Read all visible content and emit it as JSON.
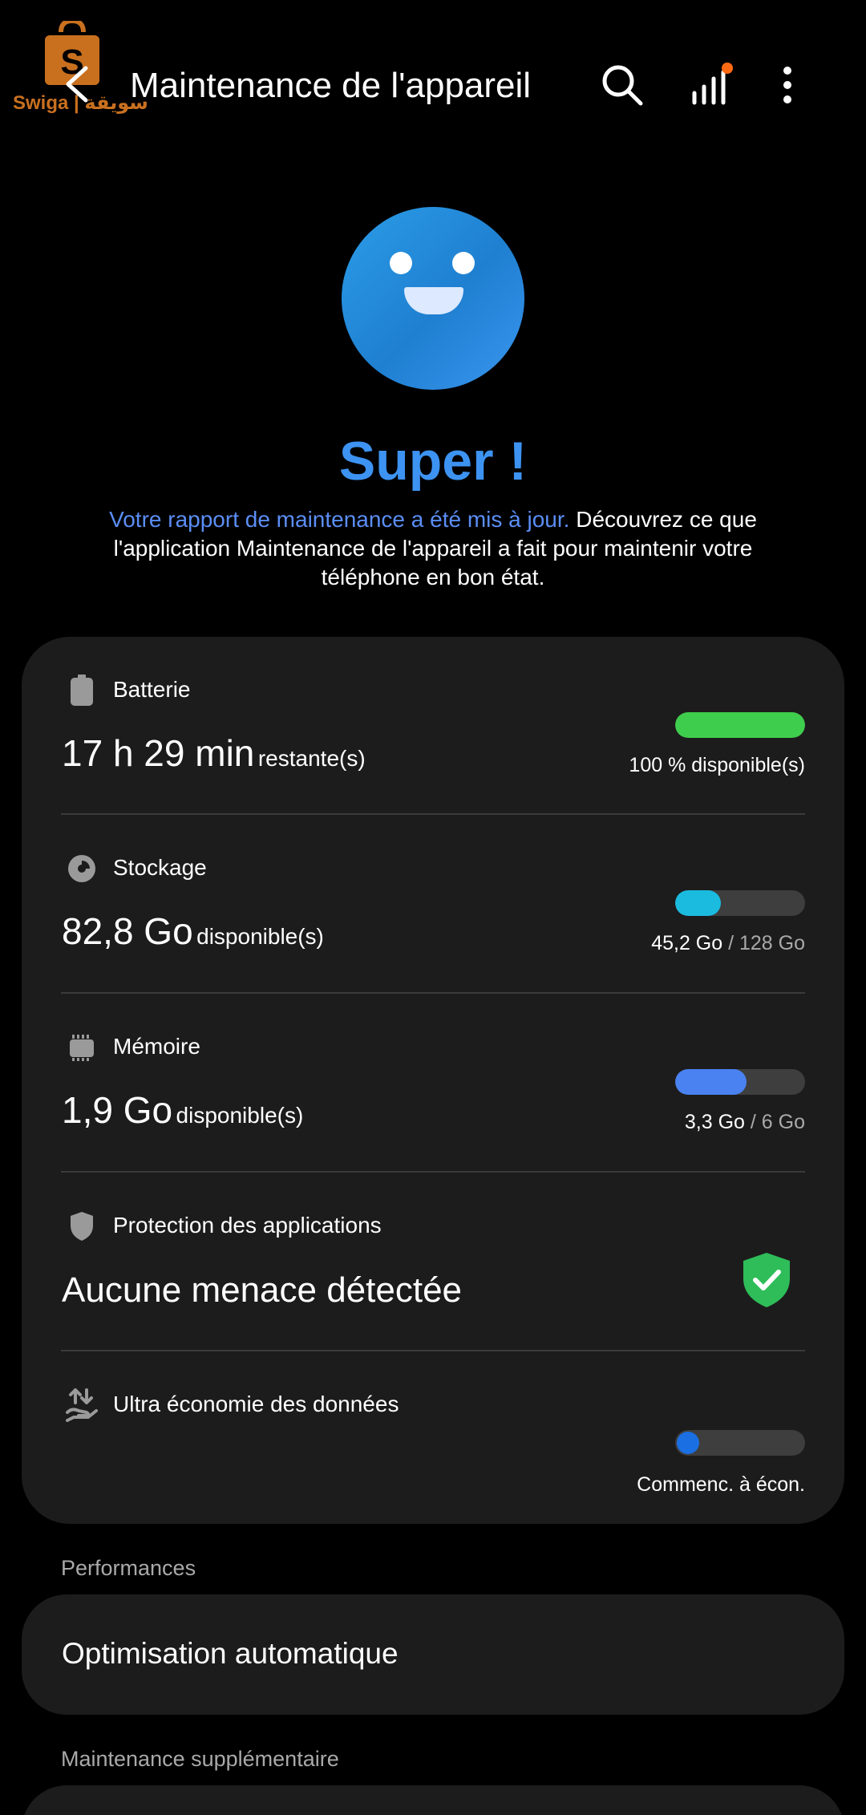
{
  "watermark": {
    "text": "Swiga | سويقة"
  },
  "header": {
    "title": "Maintenance de l'appareil",
    "icons": [
      "back-icon",
      "search-icon",
      "bar-chart-icon",
      "more-vertical-icon"
    ],
    "notification_dot_color": "#ff6a13"
  },
  "status": {
    "face_icon": "smiley-face-icon",
    "headline": "Super !",
    "desc_highlight": "Votre rapport de maintenance a été mis à jour.",
    "desc_rest": " Découvrez ce que l'application Maintenance de l'appareil a fait pour maintenir votre téléphone en bon état."
  },
  "battery": {
    "label": "Batterie",
    "value": "17 h 29 min",
    "suffix": "restante(s)",
    "right": "100 % disponible(s)",
    "level": 1.0,
    "color": "#3ecd4c",
    "icon": "battery-icon"
  },
  "storage": {
    "label": "Stockage",
    "value": "82,8 Go",
    "suffix": "disponible(s)",
    "used": "45,2 Go",
    "total": "/ 128 Go",
    "level": 0.353,
    "color": "#1bbbe0",
    "icon": "pie-chart-icon"
  },
  "memory": {
    "label": "Mémoire",
    "value": "1,9 Go",
    "suffix": "disponible(s)",
    "used": "3,3 Go",
    "total": "/ 6 Go",
    "level": 0.55,
    "color": "#4a82f2",
    "icon": "memory-chip-icon"
  },
  "protection": {
    "label": "Protection des applications",
    "status": "Aucune menace détectée",
    "icon": "shield-icon",
    "status_icon": "shield-check-icon",
    "status_color": "#2ebd59"
  },
  "data_saver": {
    "label": "Ultra économie des données",
    "right": "Commenc. à écon.",
    "toggle_on": false,
    "color": "#1a6fe3",
    "icon": "data-transfer-icon"
  },
  "sections": {
    "performance_title": "Performances",
    "auto_optimization": "Optimisation automatique",
    "extra_title": "Maintenance supplémentaire"
  }
}
